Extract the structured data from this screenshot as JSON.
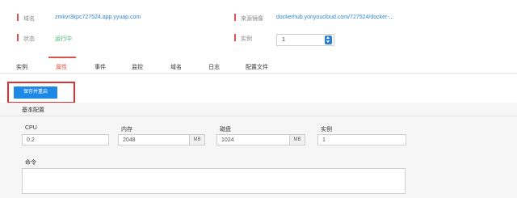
{
  "info": {
    "domain_label": "域名",
    "domain_value": "zmkvr3kpc727524.app.yyuap.com",
    "image_label": "来源镜像",
    "image_value": "dockerhub.yonyoucloud.com/727524/docker-...",
    "status_label": "状态",
    "status_value": "运行中",
    "instance_label": "实例",
    "instance_value": "1"
  },
  "tabs": [
    {
      "label": "实例"
    },
    {
      "label": "属性"
    },
    {
      "label": "事件"
    },
    {
      "label": "监控"
    },
    {
      "label": "域名"
    },
    {
      "label": "日志"
    },
    {
      "label": "配置文件"
    }
  ],
  "save_button_label": "保存并重启",
  "section": {
    "title": "基本配置",
    "cpu_label": "CPU",
    "cpu_value": "0.2",
    "memory_label": "内存",
    "memory_value": "2048",
    "memory_unit": "MB",
    "disk_label": "磁盘",
    "disk_value": "1024",
    "disk_unit": "MB",
    "instance_label": "实例",
    "instance_value": "1",
    "command_label": "命令"
  },
  "colors": {
    "accent": "#1e88e5",
    "active_tab": "#e84c3d",
    "highlight_border": "#e03030",
    "status_green": "#3cb371",
    "link": "#2e87d6"
  }
}
